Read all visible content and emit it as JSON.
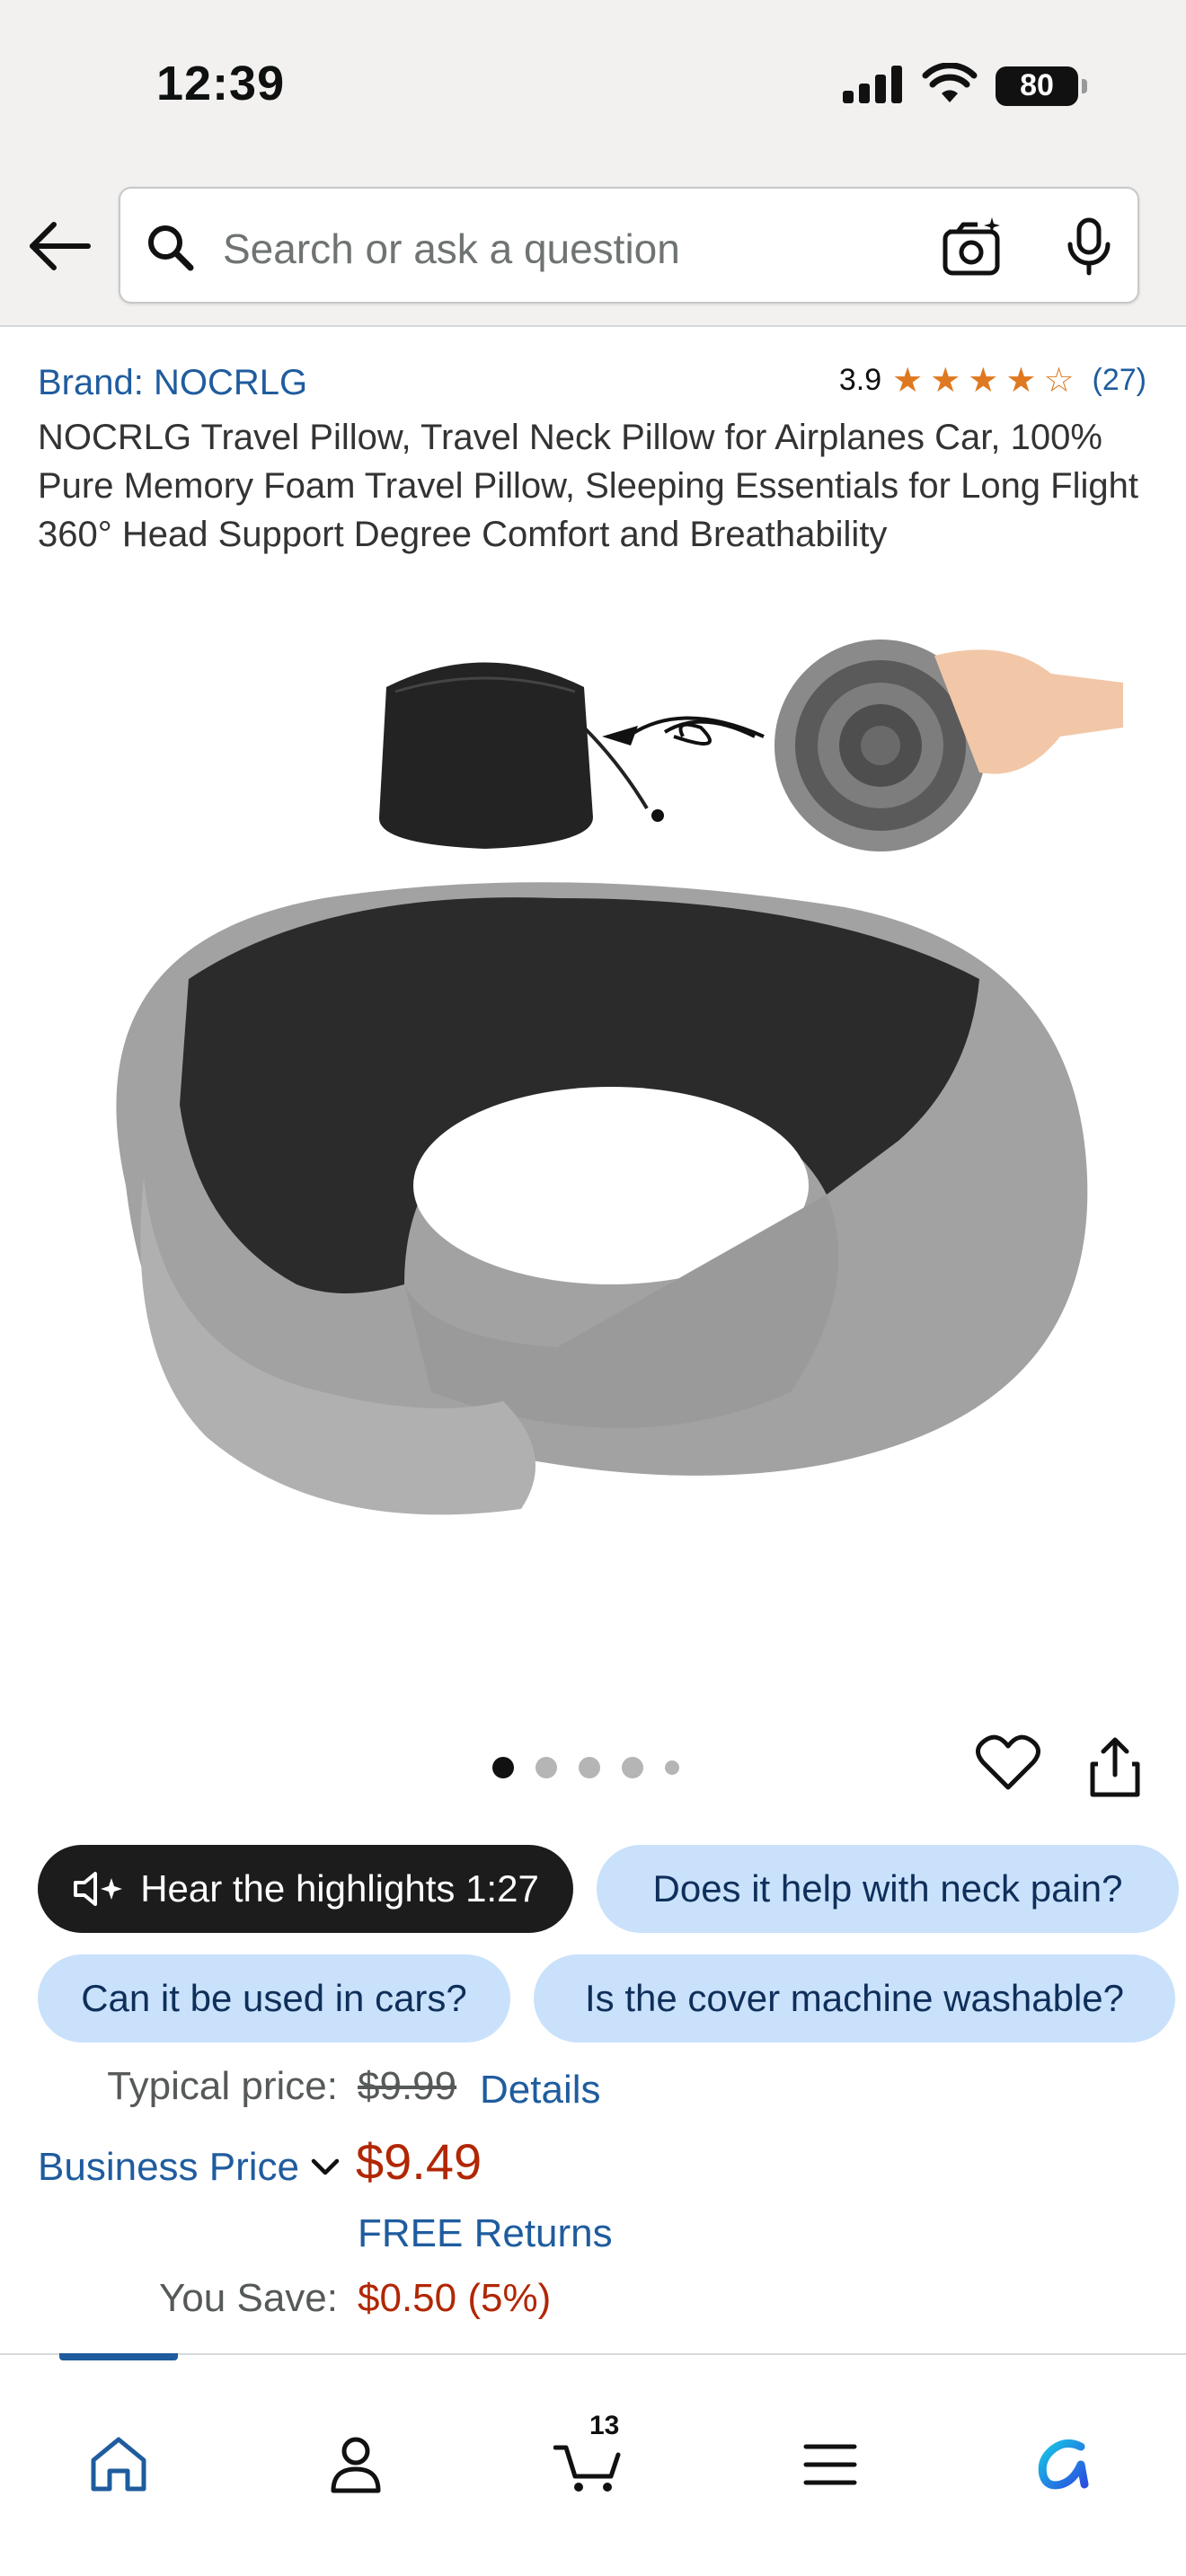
{
  "status_bar": {
    "time": "12:39",
    "battery": "80"
  },
  "search": {
    "placeholder": "Search or ask a question"
  },
  "product": {
    "brand_label": "Brand: NOCRLG",
    "rating_value": "3.9",
    "rating_stars": 3.9,
    "rating_count": "(27)",
    "title": "NOCRLG Travel Pillow, Travel Neck Pillow for Airplanes Car, 100% Pure Memory Foam Travel Pillow, Sleeping Essentials for Long Flight 360° Head Support Degree Comfort and Breathability",
    "image_count": 5,
    "active_image": 1
  },
  "chips": {
    "hear_highlights": "Hear the highlights 1:27",
    "q1": "Does it help with neck pain?",
    "q2": "Can it be used in cars?",
    "q3": "Is the cover machine washable?"
  },
  "pricing": {
    "typical_label": "Typical price:",
    "typical_value": "$9.99",
    "details_link": "Details",
    "business_label": "Business Price",
    "price": "$9.49",
    "free_returns": "FREE Returns",
    "you_save_label": "You Save:",
    "you_save_value": "$0.50 (5%)"
  },
  "bottom_nav": {
    "cart_count": "13"
  },
  "colors": {
    "link": "#1f5c9e",
    "price": "#b12704",
    "chip_light": "#c9e1fb",
    "star": "#de7921"
  }
}
